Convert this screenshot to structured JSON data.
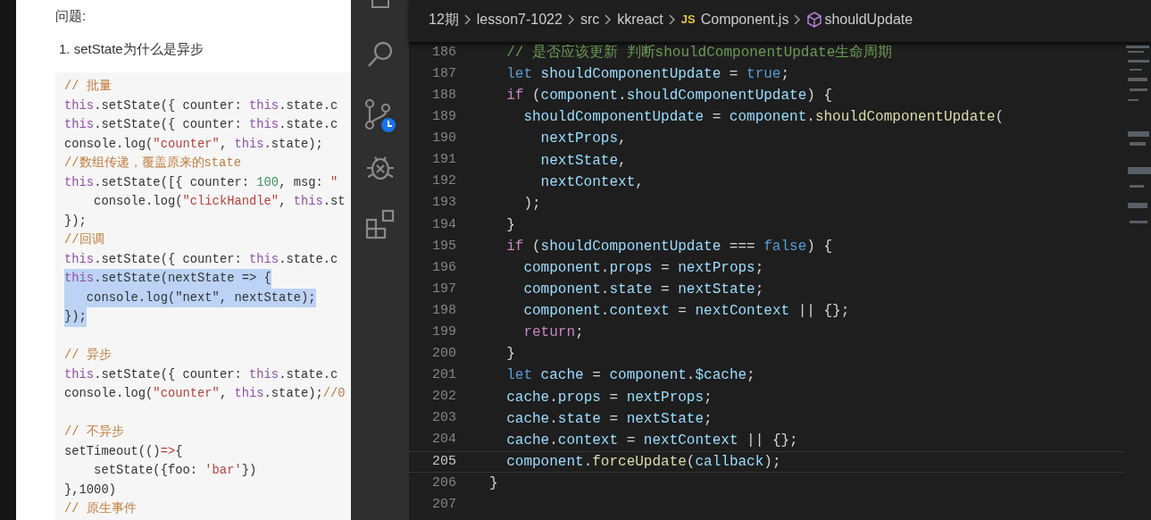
{
  "document": {
    "heading": "问题:",
    "list_item": "1. setState为什么是异步",
    "code_lines": [
      {
        "kind": "code",
        "selected": false,
        "tokens": [
          {
            "kind": "comment",
            "text": "// 批量"
          }
        ]
      },
      {
        "kind": "code",
        "selected": false,
        "tokens": [
          {
            "kind": "keyword",
            "text": "this"
          },
          {
            "kind": "plain",
            "text": ".setState({ counter: "
          },
          {
            "kind": "keyword",
            "text": "this"
          },
          {
            "kind": "plain",
            "text": ".state.c"
          }
        ]
      },
      {
        "kind": "code",
        "selected": false,
        "tokens": [
          {
            "kind": "keyword",
            "text": "this"
          },
          {
            "kind": "plain",
            "text": ".setState({ counter: "
          },
          {
            "kind": "keyword",
            "text": "this"
          },
          {
            "kind": "plain",
            "text": ".state.c"
          }
        ]
      },
      {
        "kind": "code",
        "selected": false,
        "tokens": [
          {
            "kind": "plain",
            "text": "console.log("
          },
          {
            "kind": "string",
            "text": "\"counter\""
          },
          {
            "kind": "plain",
            "text": ", "
          },
          {
            "kind": "keyword",
            "text": "this"
          },
          {
            "kind": "plain",
            "text": ".state);"
          }
        ]
      },
      {
        "kind": "code",
        "selected": false,
        "tokens": [
          {
            "kind": "comment",
            "text": "//数组传递，覆盖原来的state"
          }
        ]
      },
      {
        "kind": "code",
        "selected": false,
        "tokens": [
          {
            "kind": "keyword",
            "text": "this"
          },
          {
            "kind": "plain",
            "text": ".setState([{ counter: "
          },
          {
            "kind": "number",
            "text": "100"
          },
          {
            "kind": "plain",
            "text": ", msg: "
          },
          {
            "kind": "string",
            "text": "\""
          }
        ]
      },
      {
        "kind": "code",
        "selected": false,
        "tokens": [
          {
            "kind": "plain",
            "text": "    console.log("
          },
          {
            "kind": "string",
            "text": "\"clickHandle\""
          },
          {
            "kind": "plain",
            "text": ", "
          },
          {
            "kind": "keyword",
            "text": "this"
          },
          {
            "kind": "plain",
            "text": ".st"
          }
        ]
      },
      {
        "kind": "code",
        "selected": false,
        "tokens": [
          {
            "kind": "plain",
            "text": "});"
          }
        ]
      },
      {
        "kind": "code",
        "selected": false,
        "tokens": [
          {
            "kind": "comment",
            "text": "//回调"
          }
        ]
      },
      {
        "kind": "code",
        "selected": false,
        "tokens": [
          {
            "kind": "keyword",
            "text": "this"
          },
          {
            "kind": "plain",
            "text": ".setState({ counter: "
          },
          {
            "kind": "keyword",
            "text": "this"
          },
          {
            "kind": "plain",
            "text": ".state.c"
          }
        ]
      },
      {
        "kind": "code",
        "selected": true,
        "tokens": [
          {
            "kind": "keyword",
            "text": "this"
          },
          {
            "kind": "plain",
            "text": ".setState(nextState => {"
          }
        ]
      },
      {
        "kind": "code",
        "selected": true,
        "tokens": [
          {
            "kind": "plain",
            "text": "   console.log(\"next\", nextState);"
          }
        ]
      },
      {
        "kind": "code",
        "selected": true,
        "tokens": [
          {
            "kind": "plain",
            "text": "});"
          }
        ]
      },
      {
        "kind": "blank"
      },
      {
        "kind": "code",
        "selected": false,
        "tokens": [
          {
            "kind": "comment",
            "text": "// 异步"
          }
        ]
      },
      {
        "kind": "code",
        "selected": false,
        "tokens": [
          {
            "kind": "keyword",
            "text": "this"
          },
          {
            "kind": "plain",
            "text": ".setState({ counter: "
          },
          {
            "kind": "keyword",
            "text": "this"
          },
          {
            "kind": "plain",
            "text": ".state.c"
          }
        ]
      },
      {
        "kind": "code",
        "selected": false,
        "tokens": [
          {
            "kind": "plain",
            "text": "console.log("
          },
          {
            "kind": "string",
            "text": "\"counter\""
          },
          {
            "kind": "plain",
            "text": ", "
          },
          {
            "kind": "keyword",
            "text": "this"
          },
          {
            "kind": "plain",
            "text": ".state);"
          },
          {
            "kind": "comment",
            "text": "//0"
          }
        ]
      },
      {
        "kind": "blank"
      },
      {
        "kind": "code",
        "selected": false,
        "tokens": [
          {
            "kind": "comment",
            "text": "// 不异步"
          }
        ]
      },
      {
        "kind": "code",
        "selected": false,
        "tokens": [
          {
            "kind": "plain",
            "text": "setTimeout(()"
          },
          {
            "kind": "string",
            "text": "=>"
          },
          {
            "kind": "plain",
            "text": "{"
          }
        ]
      },
      {
        "kind": "code",
        "selected": false,
        "tokens": [
          {
            "kind": "plain",
            "text": "    setState({foo: "
          },
          {
            "kind": "string",
            "text": "'bar'"
          },
          {
            "kind": "plain",
            "text": "})"
          }
        ]
      },
      {
        "kind": "code",
        "selected": false,
        "tokens": [
          {
            "kind": "plain",
            "text": "},1000)"
          }
        ]
      },
      {
        "kind": "code",
        "selected": false,
        "tokens": [
          {
            "kind": "comment",
            "text": "// 原生事件"
          }
        ]
      }
    ]
  },
  "editor": {
    "breadcrumb": [
      {
        "kind": "folder",
        "label": "12期"
      },
      {
        "kind": "folder",
        "label": "lesson7-1022"
      },
      {
        "kind": "folder",
        "label": "src"
      },
      {
        "kind": "folder",
        "label": "kkreact"
      },
      {
        "kind": "file",
        "badge": "JS",
        "label": "Component.js"
      },
      {
        "kind": "symbol",
        "label": "shouldUpdate"
      }
    ],
    "lines": [
      {
        "number": "186",
        "current": false,
        "tokens": [
          {
            "kind": "comment",
            "text": "  // 是否应该更新 判断shouldComponentUpdate生命周期"
          }
        ]
      },
      {
        "number": "187",
        "current": false,
        "tokens": [
          {
            "kind": "storage",
            "text": "  let"
          },
          {
            "kind": "variable",
            "text": " shouldComponentUpdate"
          },
          {
            "kind": "plain",
            "text": " = "
          },
          {
            "kind": "storage",
            "text": "true"
          },
          {
            "kind": "plain",
            "text": ";"
          }
        ]
      },
      {
        "number": "188",
        "current": false,
        "tokens": [
          {
            "kind": "control",
            "text": "  if"
          },
          {
            "kind": "plain",
            "text": " ("
          },
          {
            "kind": "variable",
            "text": "component"
          },
          {
            "kind": "plain",
            "text": "."
          },
          {
            "kind": "variable",
            "text": "shouldComponentUpdate"
          },
          {
            "kind": "plain",
            "text": ") {"
          }
        ]
      },
      {
        "number": "189",
        "current": false,
        "tokens": [
          {
            "kind": "variable",
            "text": "    shouldComponentUpdate"
          },
          {
            "kind": "plain",
            "text": " = "
          },
          {
            "kind": "variable",
            "text": "component"
          },
          {
            "kind": "plain",
            "text": "."
          },
          {
            "kind": "function",
            "text": "shouldComponentUpdate"
          },
          {
            "kind": "plain",
            "text": "("
          }
        ]
      },
      {
        "number": "190",
        "current": false,
        "tokens": [
          {
            "kind": "variable",
            "text": "      nextProps"
          },
          {
            "kind": "plain",
            "text": ","
          }
        ]
      },
      {
        "number": "191",
        "current": false,
        "tokens": [
          {
            "kind": "variable",
            "text": "      nextState"
          },
          {
            "kind": "plain",
            "text": ","
          }
        ]
      },
      {
        "number": "192",
        "current": false,
        "tokens": [
          {
            "kind": "variable",
            "text": "      nextContext"
          },
          {
            "kind": "plain",
            "text": ","
          }
        ]
      },
      {
        "number": "193",
        "current": false,
        "tokens": [
          {
            "kind": "plain",
            "text": "    );"
          }
        ]
      },
      {
        "number": "194",
        "current": false,
        "tokens": [
          {
            "kind": "plain",
            "text": "  }"
          }
        ]
      },
      {
        "number": "195",
        "current": false,
        "tokens": [
          {
            "kind": "control",
            "text": "  if"
          },
          {
            "kind": "plain",
            "text": " ("
          },
          {
            "kind": "variable",
            "text": "shouldComponentUpdate"
          },
          {
            "kind": "plain",
            "text": " === "
          },
          {
            "kind": "storage",
            "text": "false"
          },
          {
            "kind": "plain",
            "text": ") {"
          }
        ]
      },
      {
        "number": "196",
        "current": false,
        "tokens": [
          {
            "kind": "variable",
            "text": "    component"
          },
          {
            "kind": "plain",
            "text": "."
          },
          {
            "kind": "variable",
            "text": "props"
          },
          {
            "kind": "plain",
            "text": " = "
          },
          {
            "kind": "variable",
            "text": "nextProps"
          },
          {
            "kind": "plain",
            "text": ";"
          }
        ]
      },
      {
        "number": "197",
        "current": false,
        "tokens": [
          {
            "kind": "variable",
            "text": "    component"
          },
          {
            "kind": "plain",
            "text": "."
          },
          {
            "kind": "variable",
            "text": "state"
          },
          {
            "kind": "plain",
            "text": " = "
          },
          {
            "kind": "variable",
            "text": "nextState"
          },
          {
            "kind": "plain",
            "text": ";"
          }
        ]
      },
      {
        "number": "198",
        "current": false,
        "tokens": [
          {
            "kind": "variable",
            "text": "    component"
          },
          {
            "kind": "plain",
            "text": "."
          },
          {
            "kind": "variable",
            "text": "context"
          },
          {
            "kind": "plain",
            "text": " = "
          },
          {
            "kind": "variable",
            "text": "nextContext"
          },
          {
            "kind": "plain",
            "text": " || {};"
          }
        ]
      },
      {
        "number": "199",
        "current": false,
        "tokens": [
          {
            "kind": "control",
            "text": "    return"
          },
          {
            "kind": "plain",
            "text": ";"
          }
        ]
      },
      {
        "number": "200",
        "current": false,
        "tokens": [
          {
            "kind": "plain",
            "text": "  }"
          }
        ]
      },
      {
        "number": "201",
        "current": false,
        "tokens": [
          {
            "kind": "storage",
            "text": "  let"
          },
          {
            "kind": "variable",
            "text": " cache"
          },
          {
            "kind": "plain",
            "text": " = "
          },
          {
            "kind": "variable",
            "text": "component"
          },
          {
            "kind": "plain",
            "text": "."
          },
          {
            "kind": "variable",
            "text": "$cache"
          },
          {
            "kind": "plain",
            "text": ";"
          }
        ]
      },
      {
        "number": "202",
        "current": false,
        "tokens": [
          {
            "kind": "variable",
            "text": "  cache"
          },
          {
            "kind": "plain",
            "text": "."
          },
          {
            "kind": "variable",
            "text": "props"
          },
          {
            "kind": "plain",
            "text": " = "
          },
          {
            "kind": "variable",
            "text": "nextProps"
          },
          {
            "kind": "plain",
            "text": ";"
          }
        ]
      },
      {
        "number": "203",
        "current": false,
        "tokens": [
          {
            "kind": "variable",
            "text": "  cache"
          },
          {
            "kind": "plain",
            "text": "."
          },
          {
            "kind": "variable",
            "text": "state"
          },
          {
            "kind": "plain",
            "text": " = "
          },
          {
            "kind": "variable",
            "text": "nextState"
          },
          {
            "kind": "plain",
            "text": ";"
          }
        ]
      },
      {
        "number": "204",
        "current": false,
        "tokens": [
          {
            "kind": "variable",
            "text": "  cache"
          },
          {
            "kind": "plain",
            "text": "."
          },
          {
            "kind": "variable",
            "text": "context"
          },
          {
            "kind": "plain",
            "text": " = "
          },
          {
            "kind": "variable",
            "text": "nextContext"
          },
          {
            "kind": "plain",
            "text": " || {};"
          }
        ]
      },
      {
        "number": "205",
        "current": true,
        "tokens": [
          {
            "kind": "variable",
            "text": "  component"
          },
          {
            "kind": "plain",
            "text": "."
          },
          {
            "kind": "function",
            "text": "forceUpdate"
          },
          {
            "kind": "plain",
            "text": "("
          },
          {
            "kind": "variable",
            "text": "callback"
          },
          {
            "kind": "plain",
            "text": ");"
          }
        ]
      },
      {
        "number": "206",
        "current": false,
        "tokens": [
          {
            "kind": "plain",
            "text": "}"
          }
        ]
      },
      {
        "number": "207",
        "current": false
      }
    ]
  }
}
